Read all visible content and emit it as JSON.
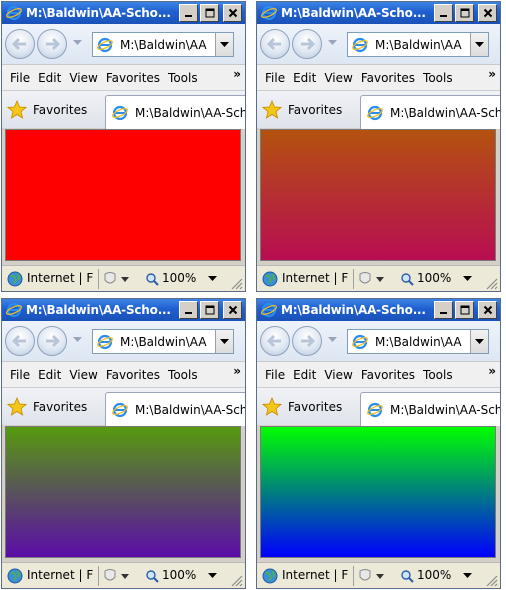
{
  "windows": [
    {
      "title": "M:\\Baldwin\\AA-Scho...",
      "address": "M:\\Baldwin\\AA",
      "tab_label": "M:\\Baldwin\\AA-Sch",
      "gradient": {
        "top": "#ff0000",
        "bottom": "#ff0000"
      }
    },
    {
      "title": "M:\\Baldwin\\AA-Scho...",
      "address": "M:\\Baldwin\\AA",
      "tab_label": "M:\\Baldwin\\AA-Sch",
      "gradient": {
        "top": "#b3520f",
        "bottom": "#b80d52"
      }
    },
    {
      "title": "M:\\Baldwin\\AA-Scho...",
      "address": "M:\\Baldwin\\AA",
      "tab_label": "M:\\Baldwin\\AA-Sch",
      "gradient": {
        "top": "#579a0e",
        "bottom": "#5a0ca8"
      }
    },
    {
      "title": "M:\\Baldwin\\AA-Scho...",
      "address": "M:\\Baldwin\\AA",
      "tab_label": "M:\\Baldwin\\AA-Sch",
      "gradient": {
        "top": "#00ff00",
        "bottom": "#0000ff"
      }
    }
  ],
  "menu": {
    "file": "File",
    "edit": "Edit",
    "view": "View",
    "favorites": "Favorites",
    "tools": "Tools",
    "more": "»"
  },
  "favorites_bar": {
    "label": "Favorites"
  },
  "status": {
    "zone": "Internet | F",
    "zoom": "100%"
  },
  "colors": {
    "titlebar": "#1f5fd0",
    "chrome": "#d4d0c8"
  }
}
